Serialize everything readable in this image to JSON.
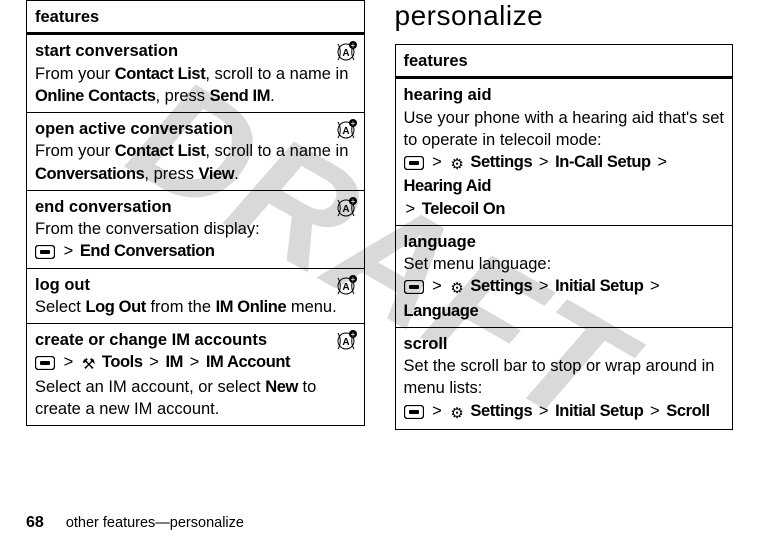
{
  "watermark": "DRAFT",
  "left": {
    "header": "features",
    "rows": [
      {
        "title": "start conversation",
        "body_parts": [
          "From your ",
          "Contact List",
          ", scroll to a name in ",
          "Online Contacts",
          ", press ",
          "Send IM",
          "."
        ]
      },
      {
        "title": "open active conversation",
        "body_parts": [
          "From your ",
          "Contact List",
          ", scroll to a name in ",
          "Conversations",
          ", press ",
          "View",
          "."
        ]
      },
      {
        "title": "end conversation",
        "body_pre": "From the conversation display:",
        "path_end": [
          "End Conversation"
        ]
      },
      {
        "title": "log out",
        "body_parts": [
          "Select ",
          "Log Out",
          " from the ",
          "IM Online",
          " menu."
        ]
      },
      {
        "title": "create or change IM accounts",
        "path_tools": [
          "Tools",
          "IM",
          "IM Account"
        ],
        "body_post_parts": [
          "Select an IM account, or select ",
          "New",
          " to create a new IM account."
        ]
      }
    ]
  },
  "right": {
    "heading": "personalize",
    "header": "features",
    "rows": [
      {
        "title": "hearing aid",
        "body": "Use your phone with a hearing aid that's set to operate in telecoil mode:",
        "path_set": [
          "Settings",
          "In-Call Setup",
          "Hearing Aid"
        ],
        "path_extra": [
          "Telecoil On"
        ]
      },
      {
        "title": "language",
        "body": "Set menu language:",
        "path_set": [
          "Settings",
          "Initial Setup",
          "Language"
        ]
      },
      {
        "title": "scroll",
        "body": "Set the scroll bar to stop or wrap around in menu lists:",
        "path_set": [
          "Settings",
          "Initial Setup",
          "Scroll"
        ]
      }
    ]
  },
  "gt": ">",
  "footer": {
    "pn": "68",
    "text": "other features—personalize"
  }
}
